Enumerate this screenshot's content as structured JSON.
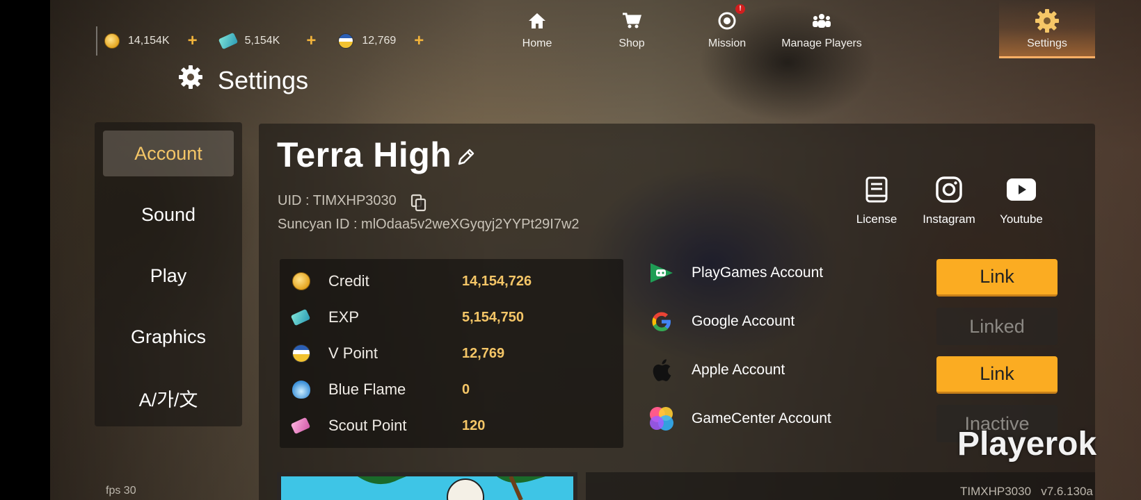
{
  "currencies": [
    {
      "icon": "credit-coin-icon",
      "value": "14,154K"
    },
    {
      "icon": "exp-ticket-icon",
      "value": "5,154K"
    },
    {
      "icon": "v-point-icon",
      "value": "12,769"
    }
  ],
  "plus_symbol": "+",
  "nav": {
    "home": "Home",
    "shop": "Shop",
    "mission": "Mission",
    "mission_badge": "!",
    "manage_players": "Manage Players",
    "settings": "Settings"
  },
  "page_title": "Settings",
  "sidebar": {
    "items": [
      {
        "label": "Account",
        "active": true
      },
      {
        "label": "Sound"
      },
      {
        "label": "Play"
      },
      {
        "label": "Graphics"
      },
      {
        "label": "A/가/文"
      }
    ]
  },
  "account": {
    "player_name": "Terra High",
    "uid": "UID : TIMXHP3030",
    "suncyan_id": "Suncyan ID : mlOdaa5v2weXGyqyj2YYPt29I7w2"
  },
  "social": {
    "license": "License",
    "instagram": "Instagram",
    "youtube": "Youtube"
  },
  "stats": [
    {
      "icon": "credit-coin-icon",
      "label": "Credit",
      "value": "14,154,726"
    },
    {
      "icon": "exp-ticket-icon",
      "label": "EXP",
      "value": "5,154,750"
    },
    {
      "icon": "v-point-icon",
      "label": "V Point",
      "value": "12,769"
    },
    {
      "icon": "blue-flame-icon",
      "label": "Blue Flame",
      "value": "0"
    },
    {
      "icon": "scout-ticket-icon",
      "label": "Scout Point",
      "value": "120"
    }
  ],
  "accounts": [
    {
      "label": "PlayGames Account",
      "button": "Link",
      "state": "link"
    },
    {
      "label": "Google Account",
      "button": "Linked",
      "state": "linked"
    },
    {
      "label": "Apple Account",
      "button": "Link",
      "state": "link"
    },
    {
      "label": "GameCenter Account",
      "button": "Inactive",
      "state": "inactive"
    }
  ],
  "footer": {
    "fps": "fps 30",
    "version": "TIMXHP3030   v7.6.130a",
    "watermark": "Playerok"
  },
  "colors": {
    "accent_gold": "#f5c667",
    "link_button": "#fbac22",
    "settings_glow": "#ffb066"
  }
}
